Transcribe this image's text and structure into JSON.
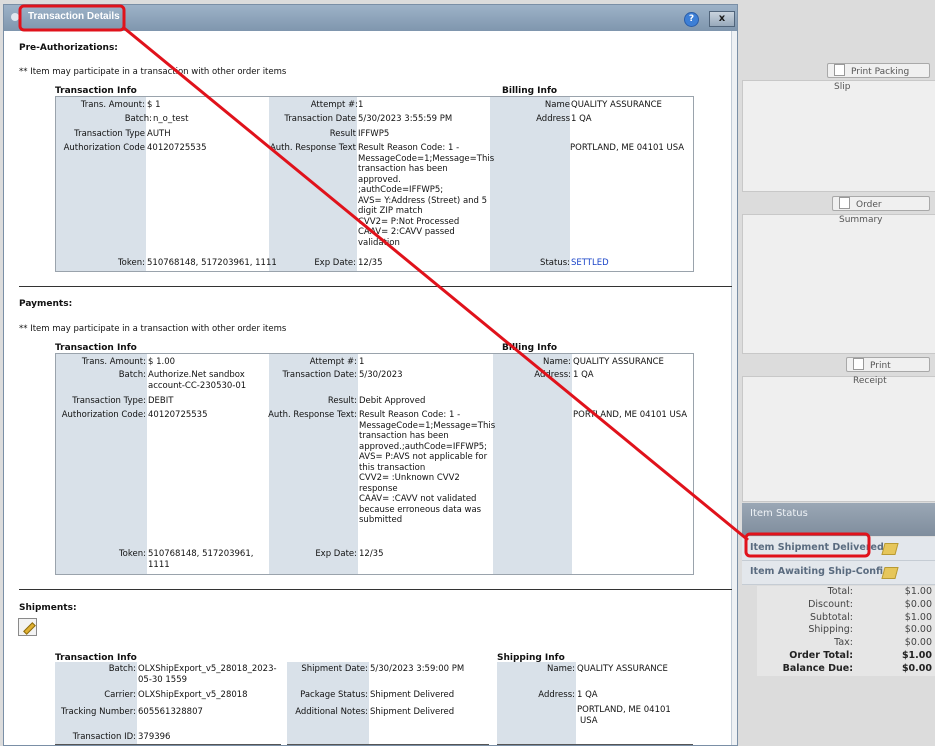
{
  "background": {
    "buttons": {
      "print_packing_slip": "Print Packing Slip",
      "order_summary": "Order Summary",
      "print_receipt": "Print Receipt"
    },
    "item_status": {
      "header": "Item Status",
      "items": [
        "Item Shipment Delivered",
        "Item Awaiting Ship-Confirm"
      ]
    },
    "totals": [
      {
        "label": "Total:",
        "value": "$1.00",
        "bold": false
      },
      {
        "label": "Discount:",
        "value": "$0.00",
        "bold": false
      },
      {
        "label": "Subtotal:",
        "value": "$1.00",
        "bold": false
      },
      {
        "label": "Shipping:",
        "value": "$0.00",
        "bold": false
      },
      {
        "label": "Tax:",
        "value": "$0.00",
        "bold": false
      },
      {
        "label": "Order Total:",
        "value": "$1.00",
        "bold": true
      },
      {
        "label": "Balance Due:",
        "value": "$0.00",
        "bold": true
      }
    ]
  },
  "dialog": {
    "title": "Transaction Details",
    "help": "?",
    "close": "x",
    "preauth": {
      "heading": "Pre-Authorizations:",
      "note": "** Item may participate in a transaction with other order items",
      "transaction_info": "Transaction Info",
      "billing_info": "Billing Info",
      "labels": {
        "amount": "Trans. Amount:",
        "batch": "Batch:",
        "type": "Transaction Type",
        "auth_code": "Authorization Code",
        "token": "Token:",
        "attempt": "Attempt #:",
        "date": "Transaction Date",
        "result": "Result",
        "response": "Auth. Response Text",
        "exp": "Exp Date:",
        "name": "Name",
        "address": "Address",
        "status": "Status:"
      },
      "values": {
        "amount": "$ 1",
        "batch": "n_o_test",
        "type": "AUTH",
        "auth_code": "40120725535",
        "token": "510768148, 517203961, 1111",
        "attempt": "1",
        "date": "5/30/2023 3:55:59 PM",
        "result": "IFFWP5",
        "response": [
          "Result Reason Code: 1 -",
          "MessageCode=1;Message=This",
          "transaction has been approved.",
          ";authCode=IFFWP5;",
          "AVS= Y:Address (Street) and 5",
          "digit ZIP match",
          "CVV2= P:Not Processed",
          "CAAV= 2:CAVV passed",
          "validation"
        ],
        "exp": "12/35",
        "name": "QUALITY ASSURANCE",
        "address1": "1 QA",
        "address2": "PORTLAND, ME 04101 USA",
        "status": "SETTLED"
      }
    },
    "payments": {
      "heading": "Payments:",
      "note": "** Item may participate in a transaction with other order items",
      "transaction_info": "Transaction Info",
      "billing_info": "Billing Info",
      "labels": {
        "amount": "Trans. Amount:",
        "batch": "Batch:",
        "type": "Transaction Type:",
        "auth_code": "Authorization Code:",
        "token": "Token:",
        "attempt": "Attempt #:",
        "date": "Transaction Date:",
        "result": "Result:",
        "response": "Auth. Response Text:",
        "exp": "Exp Date:",
        "name": "Name:",
        "address": "Address:"
      },
      "values": {
        "amount": "$ 1.00",
        "batch": [
          "Authorize.Net sandbox",
          "account-CC-230530-01"
        ],
        "type": "DEBIT",
        "auth_code": "40120725535",
        "token": [
          "510768148, 517203961,",
          "1111"
        ],
        "attempt": "1",
        "date": "5/30/2023",
        "result": "Debit Approved",
        "response": [
          "Result Reason Code: 1 -",
          "MessageCode=1;Message=This",
          "transaction has been",
          "approved.;authCode=IFFWP5;",
          "AVS= P:AVS not applicable for",
          "this transaction",
          "CVV2= :Unknown CVV2",
          "response",
          "CAAV= :CAVV not validated",
          "because erroneous data was",
          "submitted"
        ],
        "exp": "12/35",
        "name": "QUALITY ASSURANCE",
        "address1": "1 QA",
        "address2": "PORTLAND, ME 04101 USA"
      }
    },
    "shipments": {
      "heading": "Shipments:",
      "transaction_info": "Transaction Info",
      "shipping_info": "Shipping Info",
      "labels": {
        "batch": "Batch:",
        "carrier": "Carrier:",
        "tracking": "Tracking Number:",
        "txid": "Transaction ID:",
        "ship_date": "Shipment Date:",
        "pkg_status": "Package Status:",
        "notes": "Additional Notes:",
        "name": "Name:",
        "address": "Address:"
      },
      "values": {
        "batch": [
          "OLXShipExport_v5_28018_2023-",
          "05-30 1559"
        ],
        "carrier": "OLXShipExport_v5_28018",
        "tracking": "605561328807",
        "txid": "379396",
        "ship_date": "5/30/2023 3:59:00 PM",
        "pkg_status": "Shipment Delivered",
        "notes": "Shipment Delivered",
        "name": "QUALITY  ASSURANCE",
        "address1": "1 QA",
        "address2": [
          "PORTLAND, ME   04101",
          "USA"
        ]
      }
    }
  }
}
